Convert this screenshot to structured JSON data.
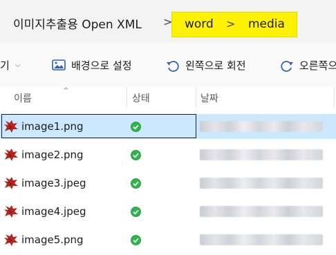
{
  "breadcrumb": {
    "root": "이미지추출용 Open XML",
    "separator": ">",
    "items": [
      "word",
      "media"
    ],
    "highlight_color": "#fff200"
  },
  "toolbar": {
    "partial_label": "기",
    "set_background": "배경으로 설정",
    "rotate_left": "왼쪽으로 회전",
    "rotate_right_partial": "오른쪽으"
  },
  "columns": {
    "name": "이름",
    "status": "상태",
    "date": "날짜"
  },
  "files": [
    {
      "name": "image1.png",
      "status": "synced",
      "selected": true
    },
    {
      "name": "image2.png",
      "status": "synced",
      "selected": false
    },
    {
      "name": "image3.jpeg",
      "status": "synced",
      "selected": false
    },
    {
      "name": "image4.jpeg",
      "status": "synced",
      "selected": false
    },
    {
      "name": "image5.png",
      "status": "synced",
      "selected": false
    }
  ],
  "icons": {
    "file": "image-file-icon",
    "status": "check-circle-icon",
    "set_background": "image-frame-icon",
    "rotate_left": "rotate-left-icon",
    "rotate_right": "rotate-right-icon"
  },
  "colors": {
    "selection": "#cce8ff",
    "status_ok": "#2fb64a",
    "file_icon": "#b3261e"
  }
}
